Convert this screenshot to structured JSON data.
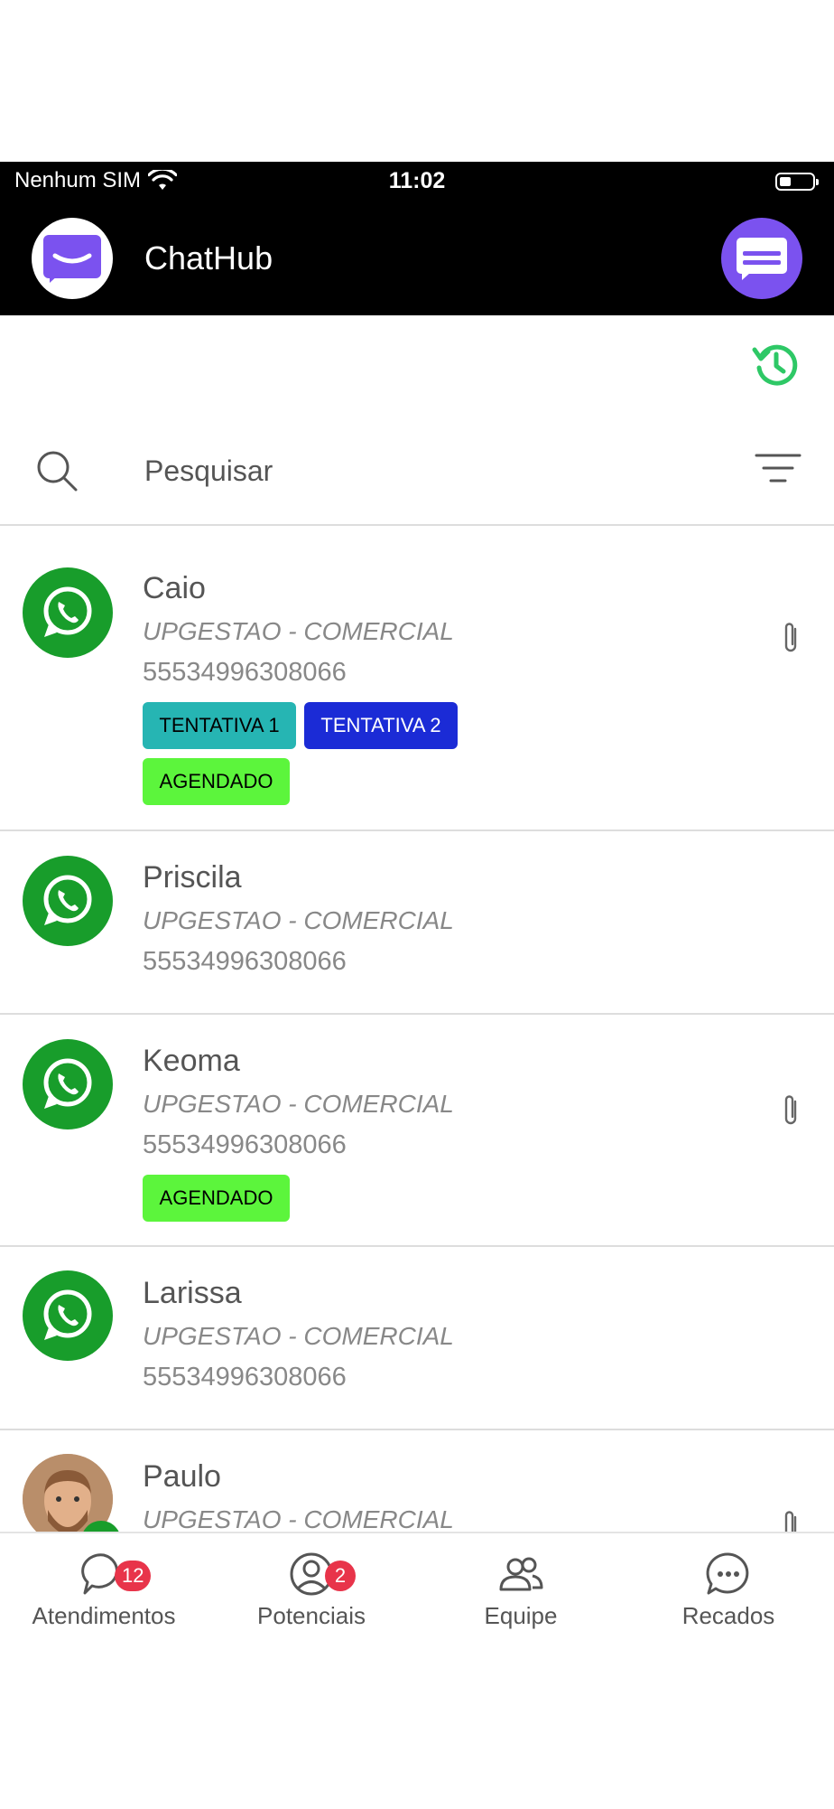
{
  "status_bar": {
    "carrier": "Nenhum SIM",
    "time": "11:02"
  },
  "header": {
    "title": "ChatHub"
  },
  "search": {
    "placeholder": "Pesquisar"
  },
  "contacts": [
    {
      "name": "Caio",
      "company": "UPGESTAO - COMERCIAL",
      "phone": "55534996308066",
      "tags": [
        {
          "label": "TENTATIVA 1",
          "color": "#26b5b3"
        },
        {
          "label": "TENTATIVA 2",
          "color": "#1b2bd6"
        },
        {
          "label": "AGENDADO",
          "color": "#5cf53c"
        }
      ]
    },
    {
      "name": "Priscila",
      "company": "UPGESTAO - COMERCIAL",
      "phone": "55534996308066",
      "tags": []
    },
    {
      "name": "Keoma",
      "company": "UPGESTAO - COMERCIAL",
      "phone": "55534996308066",
      "tags": [
        {
          "label": "AGENDADO",
          "color": "#5cf53c"
        }
      ]
    },
    {
      "name": "Larissa",
      "company": "UPGESTAO - COMERCIAL",
      "phone": "55534996308066",
      "tags": []
    },
    {
      "name": "Paulo",
      "company": "UPGESTAO - COMERCIAL",
      "phone": "",
      "tags": []
    }
  ],
  "nav": [
    {
      "label": "Atendimentos",
      "badge": "12",
      "icon": "chat-bubble-icon"
    },
    {
      "label": "Potenciais",
      "badge": "2",
      "icon": "user-circle-icon"
    },
    {
      "label": "Equipe",
      "badge": "",
      "icon": "team-icon"
    },
    {
      "label": "Recados",
      "badge": "",
      "icon": "message-dots-icon"
    }
  ],
  "colors": {
    "brand_purple": "#7b52ef",
    "whatsapp_green": "#189d2b",
    "history_green": "#2ec866",
    "badge_red": "#e8344a"
  }
}
